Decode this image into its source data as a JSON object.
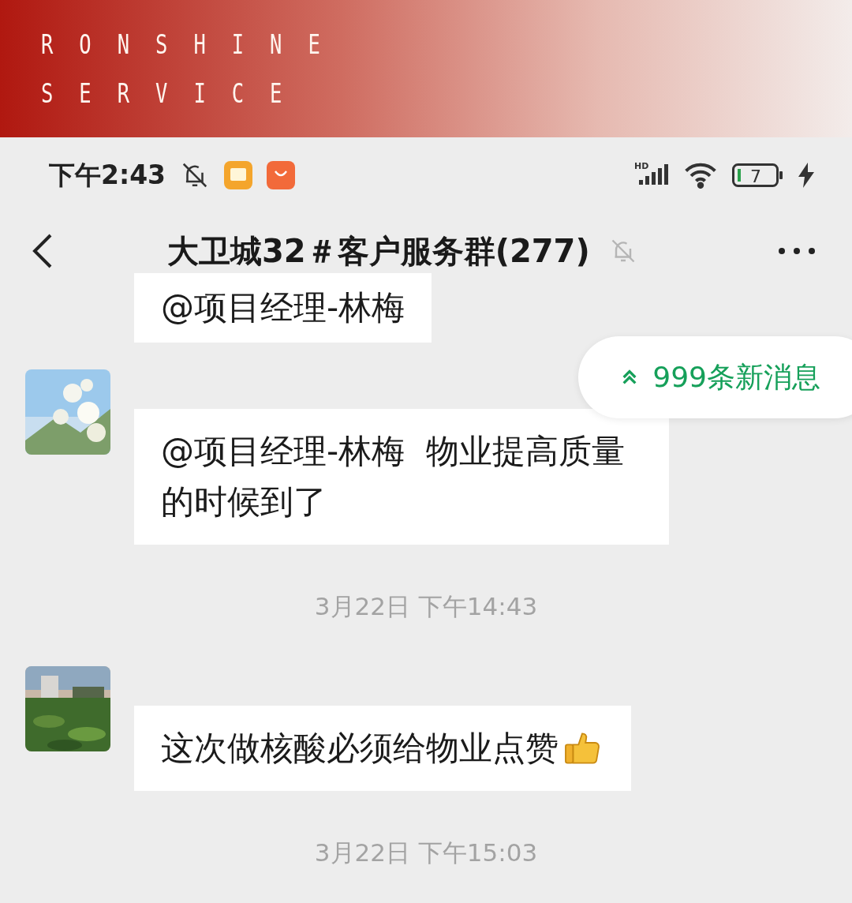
{
  "banner": {
    "lines": [
      "RONSHINE",
      "SERVICE"
    ]
  },
  "status_bar": {
    "time": "下午2:43",
    "notifications_muted": true,
    "network": "HD",
    "battery": "7",
    "charging": true
  },
  "header": {
    "title": "大卫城32＃客户服务群(277)",
    "muted": true
  },
  "new_messages": {
    "label": "999条新消息"
  },
  "messages": [
    {
      "kind": "message",
      "text": "@项目经理-林梅"
    },
    {
      "kind": "message",
      "text": "@项目经理-林梅  物业提高质量的时候到了"
    },
    {
      "kind": "time",
      "text": "3月22日 下午14:43"
    },
    {
      "kind": "message",
      "text": "这次做核酸必须给物业点赞",
      "thumbs_up": true
    },
    {
      "kind": "time",
      "text": "3月22日 下午15:03"
    }
  ]
}
